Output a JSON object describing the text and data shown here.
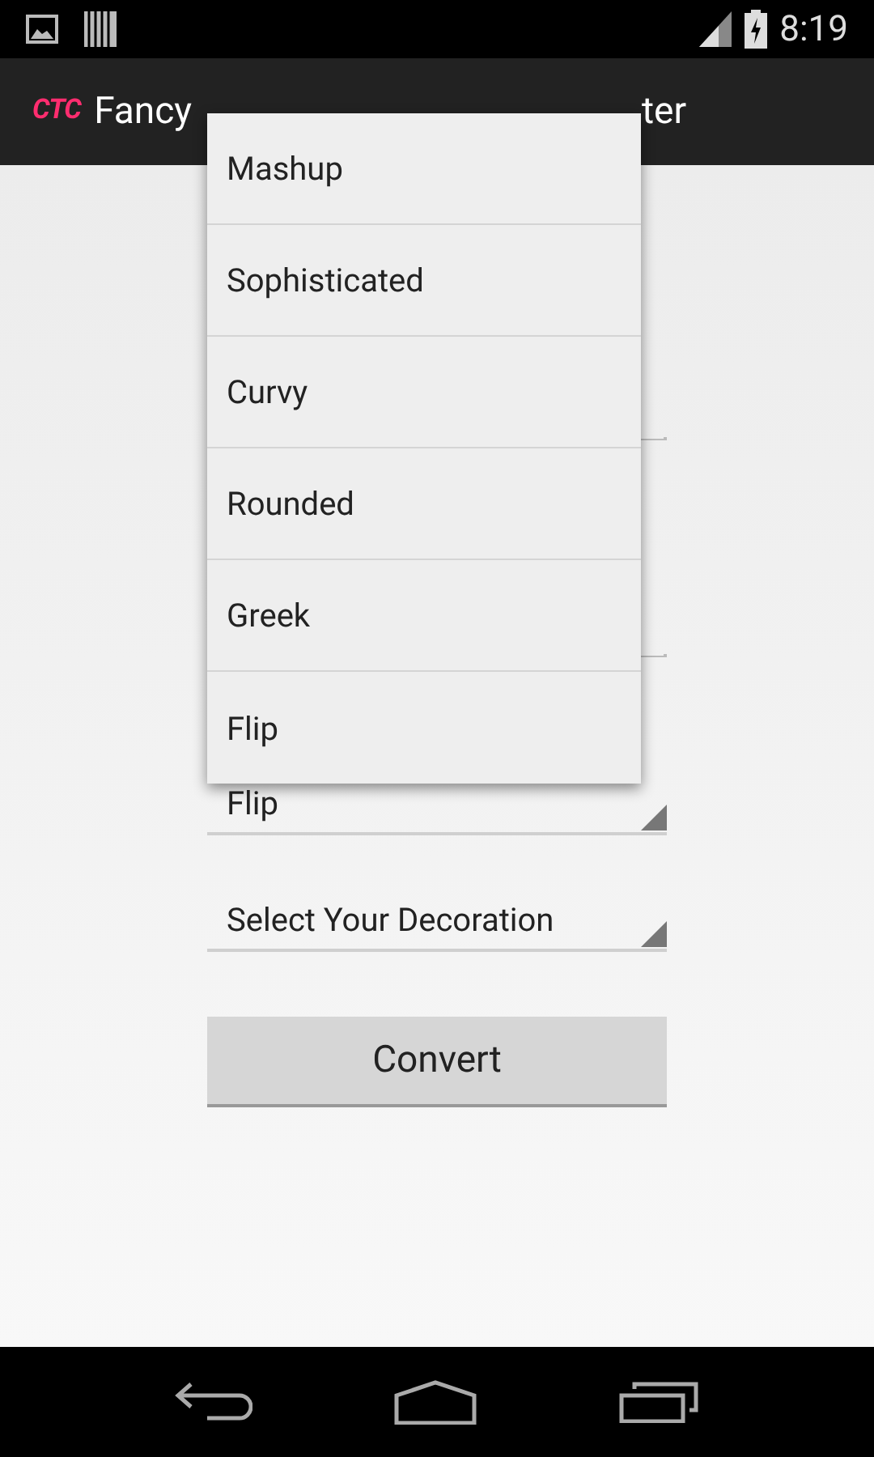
{
  "status_bar": {
    "time": "8:19"
  },
  "action_bar": {
    "logo": "CTC",
    "title_start": "Fancy",
    "title_end": "ter"
  },
  "dropdown_menu": {
    "items": [
      {
        "label": "Mashup"
      },
      {
        "label": "Sophisticated"
      },
      {
        "label": "Curvy"
      },
      {
        "label": "Rounded"
      },
      {
        "label": "Greek"
      },
      {
        "label": "Flip"
      }
    ]
  },
  "spinners": [
    {
      "value": "Flip"
    },
    {
      "value": "Select Your Decoration"
    }
  ],
  "button": "Convert"
}
